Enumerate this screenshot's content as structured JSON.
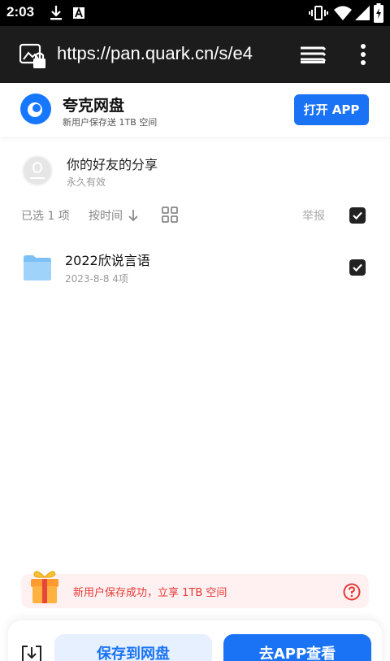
{
  "status_bar": {
    "time": "2:03"
  },
  "browser": {
    "url": "https://pan.quark.cn/s/e4"
  },
  "banner": {
    "title": "夸克网盘",
    "subtitle": "新用户保存送 1TB 空间",
    "open_app_label": "打开 APP",
    "accent": "#1a73f5"
  },
  "share": {
    "sharer_name": "你的好友的分享",
    "validity": "永久有效"
  },
  "toolbar": {
    "selected_label": "已选 1 项",
    "sort_label": "按时间",
    "report_label": "举报",
    "select_all_checked": true
  },
  "files": [
    {
      "name": "2022欣说言语",
      "meta": "2023-8-8    4项",
      "checked": true
    }
  ],
  "promo": {
    "text": "新用户保存成功，立享 1TB 空间",
    "color": "#e53935"
  },
  "bottom": {
    "save_label": "保存到网盘",
    "go_app_label": "去APP查看"
  }
}
